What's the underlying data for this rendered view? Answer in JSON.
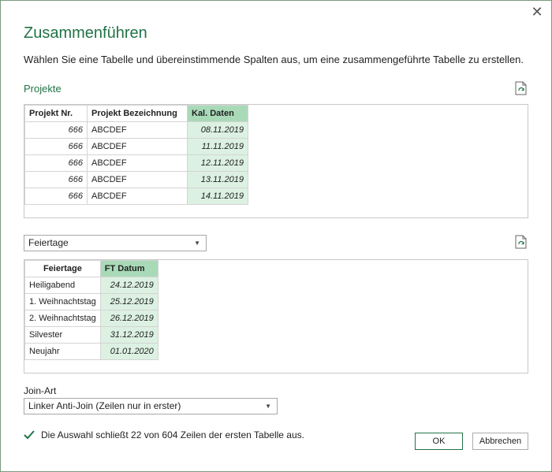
{
  "dialog": {
    "title": "Zusammenführen",
    "subtitle": "Wählen Sie eine Tabelle und übereinstimmende Spalten aus, um eine zusammengeführte Tabelle zu erstellen."
  },
  "table1": {
    "label": "Projekte",
    "headers": [
      "Projekt Nr.",
      "Projekt Bezeichnung",
      "Kal. Daten"
    ],
    "rows": [
      [
        "666",
        "ABCDEF",
        "08.11.2019"
      ],
      [
        "666",
        "ABCDEF",
        "11.11.2019"
      ],
      [
        "666",
        "ABCDEF",
        "12.11.2019"
      ],
      [
        "666",
        "ABCDEF",
        "13.11.2019"
      ],
      [
        "666",
        "ABCDEF",
        "14.11.2019"
      ]
    ]
  },
  "table2": {
    "select_value": "Feiertage",
    "headers": [
      "Feiertage",
      "FT Datum"
    ],
    "rows": [
      [
        "Heiligabend",
        "24.12.2019"
      ],
      [
        "1. Weihnachtstag",
        "25.12.2019"
      ],
      [
        "2. Weihnachtstag",
        "26.12.2019"
      ],
      [
        "Silvester",
        "31.12.2019"
      ],
      [
        "Neujahr",
        "01.01.2020"
      ]
    ]
  },
  "join": {
    "label": "Join-Art",
    "value": "Linker Anti-Join (Zeilen nur in erster)"
  },
  "status": {
    "text": "Die Auswahl schließt 22 von 604 Zeilen der ersten Tabelle aus."
  },
  "buttons": {
    "ok": "OK",
    "cancel": "Abbrechen"
  },
  "colors": {
    "accent": "#217346",
    "selected_header": "#a9dab8",
    "selected_cell": "#dcf1e2"
  }
}
